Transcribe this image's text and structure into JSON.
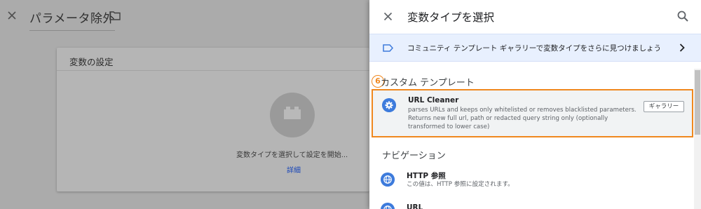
{
  "editor": {
    "title": "パラメータ除外",
    "card_title": "変数の設定",
    "card_message": "変数タイプを選択して設定を開始...",
    "card_link": "詳細"
  },
  "panel": {
    "title": "変数タイプを選択",
    "banner_text": "コミュニティ テンプレート ギャラリーで変数タイプをさらに見つけましょう",
    "step_badge": "6",
    "sections": [
      {
        "title": "カスタム テンプレート",
        "items": [
          {
            "icon": "gear-icon",
            "name": "URL Cleaner",
            "description": "parses URLs and keeps only whitelisted or removes blacklisted parameters. Returns new full url, path or redacted query string only (optionally transformed to lower case)",
            "button_label": "ギャラリー"
          }
        ]
      },
      {
        "title": "ナビゲーション",
        "items": [
          {
            "icon": "globe-icon",
            "name": "HTTP 参照",
            "description": "この値は、HTTP 参照に設定されます。"
          },
          {
            "icon": "globe-icon",
            "name": "URL",
            "description": ""
          }
        ]
      }
    ]
  },
  "colors": {
    "accent": "#3d7bdc",
    "highlight": "#f0881e",
    "banner_bg": "#e8f0fe"
  }
}
